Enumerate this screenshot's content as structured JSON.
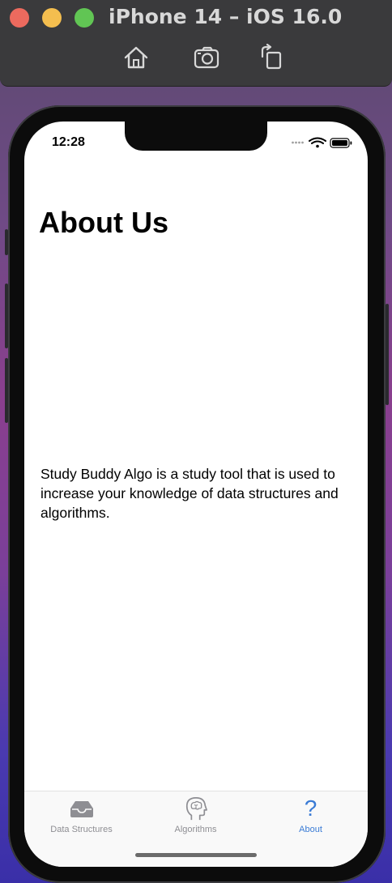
{
  "window": {
    "title": "iPhone 14 – iOS 16.0",
    "toolbar": [
      {
        "name": "home-icon"
      },
      {
        "name": "screenshot-icon"
      },
      {
        "name": "rotate-icon"
      }
    ]
  },
  "status_bar": {
    "time": "12:28",
    "icons": [
      "signal-dots-icon",
      "wifi-icon",
      "battery-icon"
    ]
  },
  "page": {
    "title": "About Us",
    "body": "Study Buddy Algo is a study tool that is used to increase your knowledge of data structures and algorithms."
  },
  "tab_bar": {
    "active_color": "#3a7bd5",
    "inactive_color": "#8e8e93",
    "tabs": [
      {
        "label": "Data Structures",
        "icon": "tray-icon",
        "active": false
      },
      {
        "label": "Algorithms",
        "icon": "brain-head-icon",
        "active": false
      },
      {
        "label": "About",
        "icon": "question-mark-icon",
        "glyph": "?",
        "active": true
      }
    ]
  }
}
